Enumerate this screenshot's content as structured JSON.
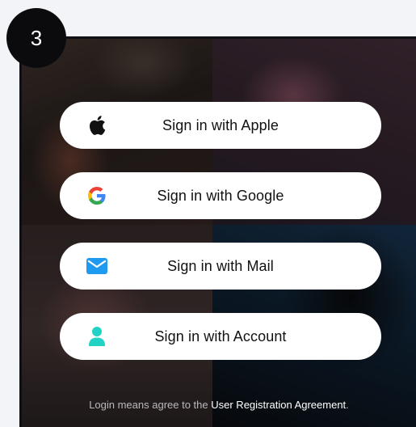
{
  "step": {
    "number": "3"
  },
  "signin": {
    "buttons": [
      {
        "label": "Sign in with Apple",
        "icon": "apple-icon"
      },
      {
        "label": "Sign in with Google",
        "icon": "google-icon"
      },
      {
        "label": "Sign in with Mail",
        "icon": "mail-icon"
      },
      {
        "label": "Sign in with Account",
        "icon": "account-icon"
      }
    ]
  },
  "footer": {
    "agreement_prefix": "Login means agree to the ",
    "agreement_link": "User Registration Agreement",
    "agreement_suffix": "."
  },
  "colors": {
    "mail_blue": "#1e9bf0",
    "account_teal": "#22d3c5",
    "google_blue": "#4285f4",
    "google_red": "#ea4335",
    "google_yellow": "#fbbc05",
    "google_green": "#34a853"
  }
}
